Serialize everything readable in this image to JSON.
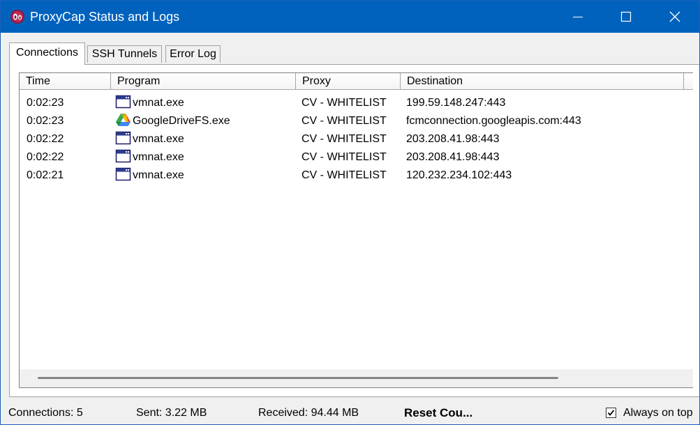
{
  "window": {
    "title": "ProxyCap Status and Logs",
    "icon": "proxycap-logo-icon",
    "controls": [
      "minimize-icon",
      "maximize-icon",
      "close-icon"
    ]
  },
  "tabs": [
    {
      "label": "Connections",
      "active": true
    },
    {
      "label": "SSH Tunnels",
      "active": false
    },
    {
      "label": "Error Log",
      "active": false
    }
  ],
  "table": {
    "columns": [
      "Time",
      "Program",
      "Proxy",
      "Destination"
    ],
    "rows": [
      {
        "time": "0:02:23",
        "program": "vmnat.exe",
        "icon": "application-window-icon",
        "proxy": "CV - WHITELIST",
        "destination": "199.59.148.247:443"
      },
      {
        "time": "0:02:23",
        "program": "GoogleDriveFS.exe",
        "icon": "google-drive-icon",
        "proxy": "CV - WHITELIST",
        "destination": "fcmconnection.googleapis.com:443"
      },
      {
        "time": "0:02:22",
        "program": "vmnat.exe",
        "icon": "application-window-icon",
        "proxy": "CV - WHITELIST",
        "destination": "203.208.41.98:443"
      },
      {
        "time": "0:02:22",
        "program": "vmnat.exe",
        "icon": "application-window-icon",
        "proxy": "CV - WHITELIST",
        "destination": "203.208.41.98:443"
      },
      {
        "time": "0:02:21",
        "program": "vmnat.exe",
        "icon": "application-window-icon",
        "proxy": "CV - WHITELIST",
        "destination": "120.232.234.102:443"
      }
    ]
  },
  "status": {
    "connections": "Connections:  5",
    "sent": "Sent:  3.22 MB",
    "received": "Received:  94.44 MB",
    "reset": "Reset Cou...",
    "always_on_top": "Always on top",
    "always_on_top_checked": true
  },
  "colors": {
    "titlebar": "#0062bd",
    "window_bg": "#f0f0f0"
  }
}
